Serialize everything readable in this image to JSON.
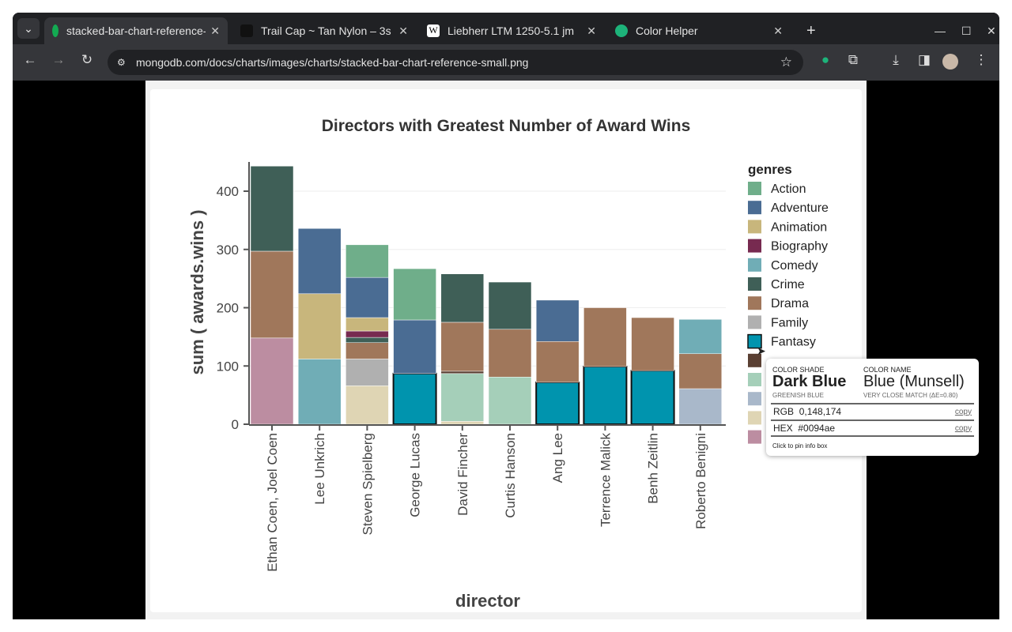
{
  "browser": {
    "tabs": [
      {
        "title": "stacked-bar-chart-reference-small.png",
        "active": true
      },
      {
        "title": "Trail Cap ~ Tan Nylon – 3s",
        "active": false
      },
      {
        "title": "Liebherr LTM 1250-5.1 jm",
        "active": false
      },
      {
        "title": "Color Helper",
        "active": false
      }
    ],
    "url": "mongodb.com/docs/charts/images/charts/stacked-bar-chart-reference-small.png",
    "icons": [
      "back-icon",
      "forward-icon",
      "reload-icon",
      "site-info-icon",
      "star-icon",
      "extension-icon",
      "puzzle-icon",
      "download-icon",
      "sidepanel-icon",
      "avatar",
      "menu-icon"
    ]
  },
  "chart_data": {
    "type": "bar",
    "stacked": true,
    "title": "Directors with Greatest Number of Award Wins",
    "xlabel": "director",
    "ylabel": "sum ( awards.wins )",
    "ylim": [
      0,
      450
    ],
    "yticks": [
      0,
      100,
      200,
      300,
      400
    ],
    "grid": true,
    "legend_title": "genres",
    "legend_position": "right",
    "categories": [
      "Ethan Coen, Joel Coen",
      "Lee Unkrich",
      "Steven Spielberg",
      "George Lucas",
      "David Fincher",
      "Curtis Hanson",
      "Ang Lee",
      "Terrence Malick",
      "Benh Zeitlin",
      "Roberto Benigni"
    ],
    "series": [
      {
        "name": "Action",
        "color": "#6fae8a",
        "values": [
          0,
          0,
          56,
          88,
          0,
          0,
          0,
          0,
          0,
          0
        ]
      },
      {
        "name": "Adventure",
        "color": "#4a6c93",
        "values": [
          0,
          112,
          69,
          92,
          0,
          0,
          71,
          0,
          0,
          0
        ]
      },
      {
        "name": "Animation",
        "color": "#c8b67c",
        "values": [
          0,
          112,
          23,
          0,
          0,
          0,
          0,
          0,
          0,
          0
        ]
      },
      {
        "name": "Biography",
        "color": "#772a50",
        "values": [
          0,
          0,
          11,
          0,
          0,
          0,
          0,
          0,
          0,
          0
        ]
      },
      {
        "name": "Comedy",
        "color": "#70adb6",
        "values": [
          0,
          112,
          0,
          0,
          0,
          0,
          0,
          0,
          0,
          59
        ]
      },
      {
        "name": "Crime",
        "color": "#3f5f57",
        "values": [
          146,
          0,
          9,
          0,
          83,
          81,
          0,
          0,
          0,
          0
        ]
      },
      {
        "name": "Drama",
        "color": "#a0775b",
        "values": [
          149,
          0,
          28,
          0,
          84,
          82,
          70,
          101,
          91,
          60
        ]
      },
      {
        "name": "Family",
        "color": "#b0b0b0",
        "values": [
          0,
          0,
          46,
          0,
          0,
          0,
          0,
          0,
          0,
          0
        ]
      },
      {
        "name": "Fantasy",
        "color": "#0094ae",
        "values": [
          0,
          0,
          0,
          87,
          0,
          0,
          72,
          99,
          92,
          0
        ],
        "highlighted": true
      },
      {
        "name": "",
        "color": "#5a4033",
        "values": [
          0,
          0,
          0,
          0,
          4,
          0,
          0,
          0,
          0,
          0
        ]
      },
      {
        "name": "",
        "color": "#a5cfb9",
        "values": [
          0,
          0,
          0,
          0,
          82,
          81,
          0,
          0,
          0,
          0
        ]
      },
      {
        "name": "",
        "color": "#a9b8ca",
        "values": [
          0,
          0,
          0,
          0,
          0,
          0,
          0,
          0,
          0,
          61
        ]
      },
      {
        "name": "",
        "color": "#dfd5b4",
        "values": [
          0,
          0,
          66,
          0,
          5,
          0,
          0,
          0,
          0,
          0
        ]
      },
      {
        "name": "",
        "color": "#bc8da1",
        "values": [
          148,
          0,
          0,
          0,
          0,
          0,
          0,
          0,
          0,
          0
        ]
      }
    ]
  },
  "tooltip": {
    "shade_label": "COLOR SHADE",
    "shade": "Dark Blue",
    "shade_sub": "GREENISH BLUE",
    "name_label": "COLOR NAME",
    "name": "Blue (Munsell)",
    "name_sub": "VERY CLOSE MATCH (ΔE=0.80)",
    "rgb_label": "RGB",
    "rgb": "0,148,174",
    "hex_label": "HEX",
    "hex": "#0094ae",
    "copy": "copy",
    "pin": "Click to pin info box"
  }
}
